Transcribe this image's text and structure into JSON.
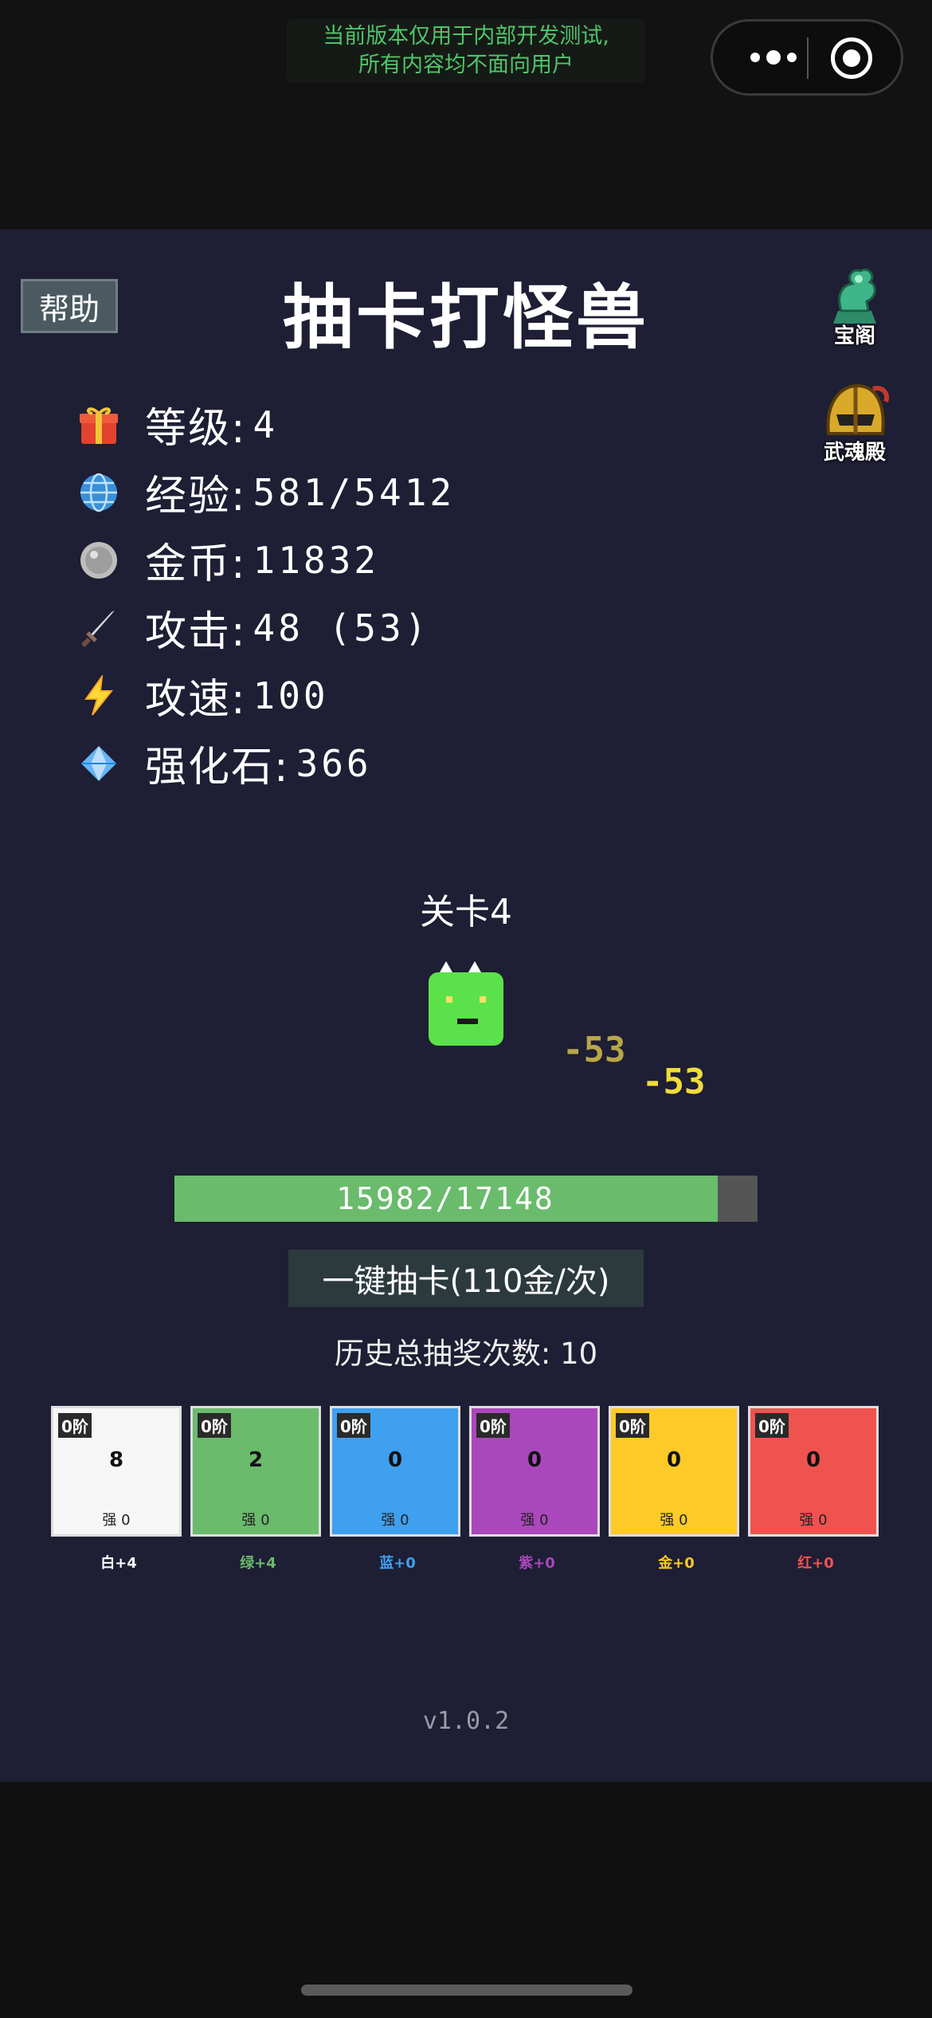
{
  "dev_notice": [
    "当前版本仅用于内部开发测试,",
    "所有内容均不面向用户"
  ],
  "title": "抽卡打怪兽",
  "help_label": "帮助",
  "side_buttons": {
    "treasure": "宝阁",
    "soul": "武魂殿"
  },
  "stats": [
    {
      "icon": "gift-icon",
      "label": "等级:",
      "value": "4"
    },
    {
      "icon": "globe-icon",
      "label": "经验:",
      "value": "581/5412"
    },
    {
      "icon": "coin-icon",
      "label": "金币:",
      "value": "11832"
    },
    {
      "icon": "sword-icon",
      "label": "攻击:",
      "value": "48 (53)"
    },
    {
      "icon": "lightning-icon",
      "label": "攻速:",
      "value": "100"
    },
    {
      "icon": "gem-icon",
      "label": "强化石:",
      "value": "366"
    }
  ],
  "stage": "关卡4",
  "damage_numbers": [
    "-53",
    "-53"
  ],
  "hp": {
    "text": "15982/17148",
    "fraction": 0.932
  },
  "draw_button": "一键抽卡(110金/次)",
  "history": "历史总抽奖次数: 10",
  "cards": [
    {
      "rank": "0阶",
      "count": "8",
      "enhance": "强 0",
      "caption": "白+4",
      "bg": "#f6f6f6",
      "caption_color": "#ffffff"
    },
    {
      "rank": "0阶",
      "count": "2",
      "enhance": "强 0",
      "caption": "绿+4",
      "bg": "#6abb6c",
      "caption_color": "#6abb6c"
    },
    {
      "rank": "0阶",
      "count": "0",
      "enhance": "强 0",
      "caption": "蓝+0",
      "bg": "#3fa0ef",
      "caption_color": "#3fa0ef"
    },
    {
      "rank": "0阶",
      "count": "0",
      "enhance": "强 0",
      "caption": "紫+0",
      "bg": "#ab47bc",
      "caption_color": "#ab47bc"
    },
    {
      "rank": "0阶",
      "count": "0",
      "enhance": "强 0",
      "caption": "金+0",
      "bg": "#fdca28",
      "caption_color": "#fdca28"
    },
    {
      "rank": "0阶",
      "count": "0",
      "enhance": "强 0",
      "caption": "红+0",
      "bg": "#ef5350",
      "caption_color": "#ef5350"
    }
  ],
  "version": "v1.0.2"
}
